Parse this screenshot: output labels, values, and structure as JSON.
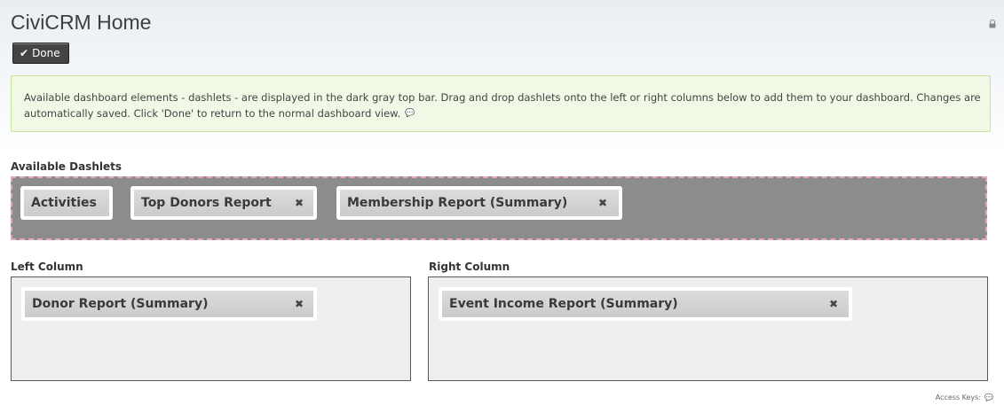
{
  "header": {
    "title": "CiviCRM Home",
    "done_label": "Done"
  },
  "help": {
    "text": "Available dashboard elements - dashlets - are displayed in the dark gray top bar. Drag and drop dashlets onto the left or right columns below to add them to your dashboard. Changes are automatically saved. Click 'Done' to return to the normal dashboard view."
  },
  "available": {
    "label": "Available Dashlets",
    "dashlets": [
      {
        "label": "Activities",
        "closable": false
      },
      {
        "label": "Top Donors Report",
        "closable": true
      },
      {
        "label": "Membership Report (Summary)",
        "closable": true
      }
    ]
  },
  "left_column": {
    "label": "Left Column",
    "dashlets": [
      {
        "label": "Donor Report (Summary)",
        "closable": true
      }
    ]
  },
  "right_column": {
    "label": "Right Column",
    "dashlets": [
      {
        "label": "Event Income Report (Summary)",
        "closable": true
      }
    ]
  },
  "footer": {
    "access_keys_label": "Access Keys:"
  },
  "icons": {
    "close": "close-icon",
    "check": "check-icon",
    "help": "help-icon",
    "lock": "lock-icon"
  },
  "colors": {
    "available_bar_bg": "#8c8c8c",
    "available_bar_border": "#e6a6b6",
    "help_box_bg": "#f1f8e6",
    "help_box_border": "#c8e39a",
    "done_button_bg": "#444444"
  }
}
